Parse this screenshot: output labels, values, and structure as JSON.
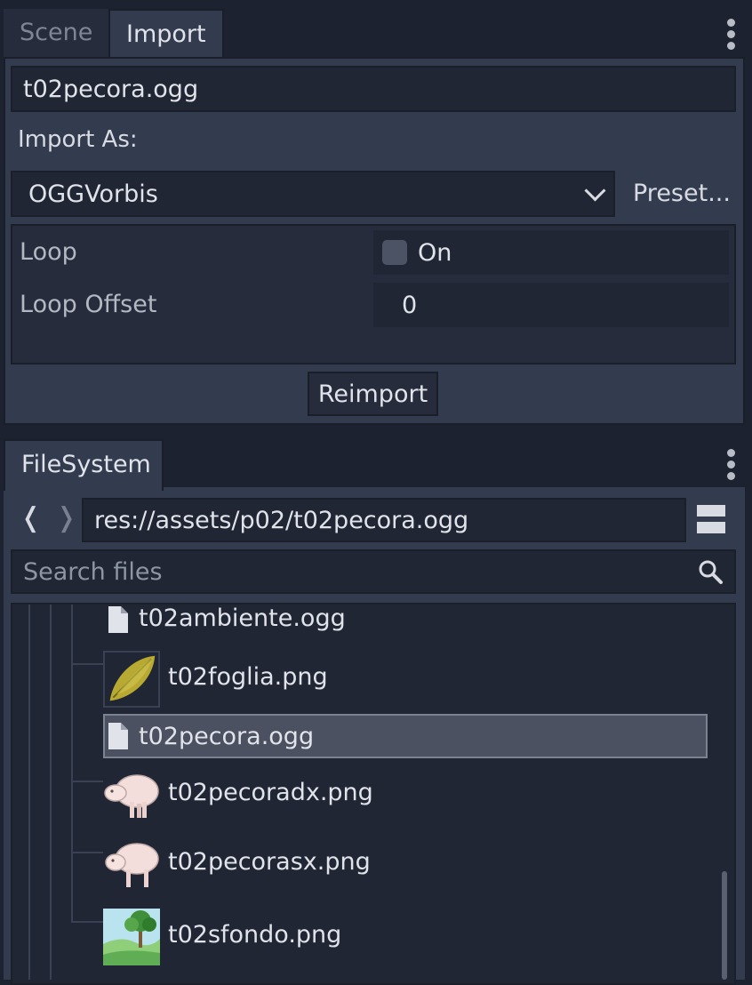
{
  "import_dock": {
    "tabs": [
      {
        "label": "Scene",
        "active": false
      },
      {
        "label": "Import",
        "active": true
      }
    ],
    "filename": "t02pecora.ogg",
    "import_as_label": "Import As:",
    "importer": "OGGVorbis",
    "preset_label": "Preset...",
    "properties": [
      {
        "name": "Loop",
        "value": "On",
        "checked": false
      },
      {
        "name": "Loop Offset",
        "value": "0"
      }
    ],
    "reimport_label": "Reimport"
  },
  "filesystem_dock": {
    "tab_label": "FileSystem",
    "path": "res://assets/p02/t02pecora.ogg",
    "search_placeholder": "Search files",
    "files": [
      {
        "name": "t02ambiente.ogg",
        "icon": "audio-file-icon"
      },
      {
        "name": "t02foglia.png",
        "icon": "leaf-thumbnail"
      },
      {
        "name": "t02pecora.ogg",
        "icon": "audio-file-icon",
        "selected": true
      },
      {
        "name": "t02pecoradx.png",
        "icon": "sheep-right-thumbnail"
      },
      {
        "name": "t02pecorasx.png",
        "icon": "sheep-left-thumbnail"
      },
      {
        "name": "t02sfondo.png",
        "icon": "background-thumbnail"
      }
    ]
  },
  "colors": {
    "panel": "#333b4f",
    "field": "#202633",
    "selection": "#4b5160",
    "text": "#e0e3ea"
  }
}
